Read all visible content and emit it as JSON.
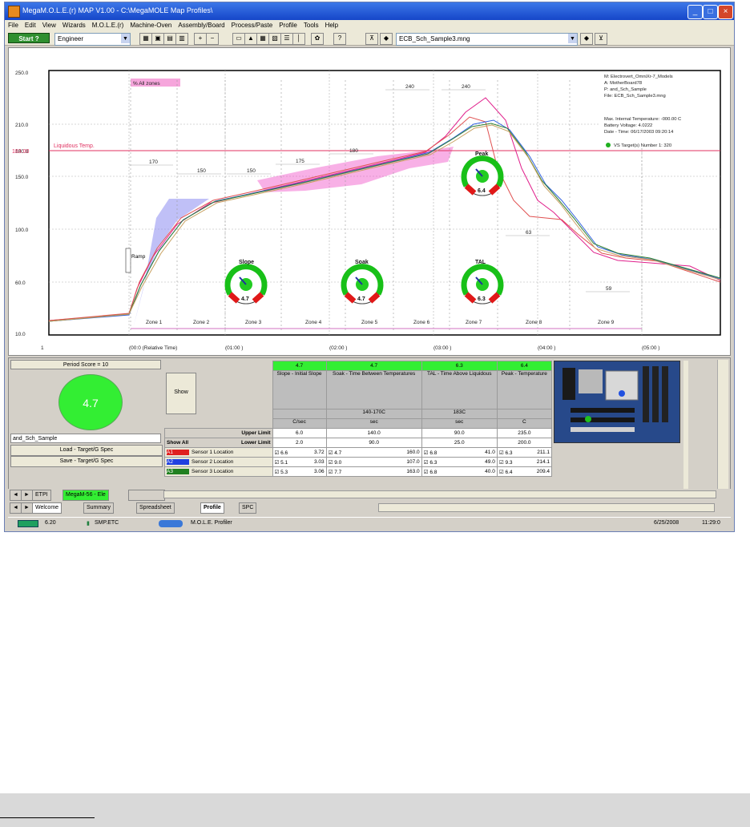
{
  "window": {
    "title": "MegaM.O.L.E.(r) MAP V1.00 - C:\\MegaMOLE Map Profiles\\",
    "controls": [
      "_",
      "□",
      "×"
    ]
  },
  "menu": [
    "File",
    "Edit",
    "View",
    "Wizards",
    "M.O.L.E.(r)",
    "Machine-Oven",
    "Assembly/Board",
    "Process/Paste",
    "Profile",
    "Tools",
    "Help"
  ],
  "toolbar": {
    "start_label": "Start ?",
    "user_value": "Engineer",
    "file_value": "ECB_Sch_Sample3.mng"
  },
  "chart": {
    "y_ticks": [
      "250.0",
      "210.0",
      "180.0",
      "150.0",
      "100.0",
      "60.0",
      "10.0"
    ],
    "liquidus_label": "Liquidous Temp.",
    "liquidus_value": "183.00",
    "x_axis_label": "Time",
    "x_ticks": [
      "1",
      "(00:0 (Relative Time)",
      "(01:00 )",
      "(02:00 )",
      "(03:00 )",
      "(04:00 )",
      "(05:00 )"
    ],
    "zones": [
      "Zone 1",
      "Zone 2",
      "Zone 3",
      "Zone 4",
      "Zone 5",
      "Zone 6",
      "Zone 7",
      "Zone 8",
      "Zone 9"
    ],
    "pink_label": "% All zones",
    "ramp_label": "Ramp",
    "info": [
      "M: Electrovert_OmniXr-7_Models",
      "A: MotherBoard78",
      "P: and_Sch_Sample",
      "File: ECB_Sch_Sample3.mng",
      "Max. Internal Temperature: -000.00 C",
      "Battery Voltage: 4.0222",
      "Date - Time: 06/17/2003 09:20:14",
      "VS Target(s) Number 1: 320"
    ],
    "interval_labels": [
      "170",
      "150",
      "150",
      "175",
      "180",
      "240",
      "240",
      "63",
      "59"
    ],
    "gauges": [
      {
        "label": "Slope",
        "value": "4.7"
      },
      {
        "label": "Soak",
        "value": "4.7"
      },
      {
        "label": "TAL",
        "value": "6.3"
      },
      {
        "label": "Peak",
        "value": "6.4"
      }
    ]
  },
  "panel": {
    "ratio_label": "Period Score = 10",
    "score_value": "4.7",
    "sample_name": "and_Sch_Sample",
    "load_button": "Load - Target/G Spec",
    "save_button": "Save - Target/G Spec",
    "show_button": "Show",
    "show_all": "Show All",
    "upper_limit_label": "Upper Limit",
    "lower_limit_label": "Lower Limit",
    "header_scores": [
      "4.7",
      "4.7",
      "6.3",
      "6.4"
    ],
    "columns": [
      {
        "title": "Slope - Initial Slope",
        "sub": "",
        "unit": "C/sec",
        "upper": "6.0",
        "lower": "2.0"
      },
      {
        "title": "Soak - Time Between Temperatures",
        "sub": "140-170C",
        "unit": "sec",
        "upper": "140.0",
        "lower": "90.0"
      },
      {
        "title": "TAL - Time Above Liquidous",
        "sub": "183C",
        "unit": "sec",
        "upper": "90.0",
        "lower": "25.0"
      },
      {
        "title": "Peak - Temperature",
        "sub": "",
        "unit": "C",
        "upper": "235.0",
        "lower": "200.0"
      }
    ],
    "sensors": [
      {
        "tag": "A1",
        "color": "#e02020",
        "name": "Sensor 1 Location",
        "vals": [
          "6.6",
          "3.72",
          "4.7",
          "160.0",
          "6.8",
          "41.0",
          "6.3",
          "211.1"
        ]
      },
      {
        "tag": "A2",
        "color": "#2040e0",
        "name": "Sensor 2 Location",
        "vals": [
          "5.1",
          "3.03",
          "9.0",
          "107.0",
          "6.3",
          "49.0",
          "9.3",
          "214.1"
        ]
      },
      {
        "tag": "A3",
        "color": "#208020",
        "name": "Sensor 3 Location",
        "vals": [
          "5.3",
          "3.06",
          "7.7",
          "163.0",
          "6.8",
          "40.0",
          "6.4",
          "209.4"
        ]
      }
    ]
  },
  "tabs_row1": [
    "ETPI",
    "MegaM-56 - Ele",
    ""
  ],
  "tabs_row2": [
    "Welcome",
    "Summary",
    "Spreadsheet",
    "Profile",
    "SPC"
  ],
  "status": {
    "left_val": "6.20",
    "mid_val": "SMP.ETC",
    "app_label": "M.O.L.E. Profiler",
    "date": "6/25/2008",
    "time": "11:29:0"
  }
}
